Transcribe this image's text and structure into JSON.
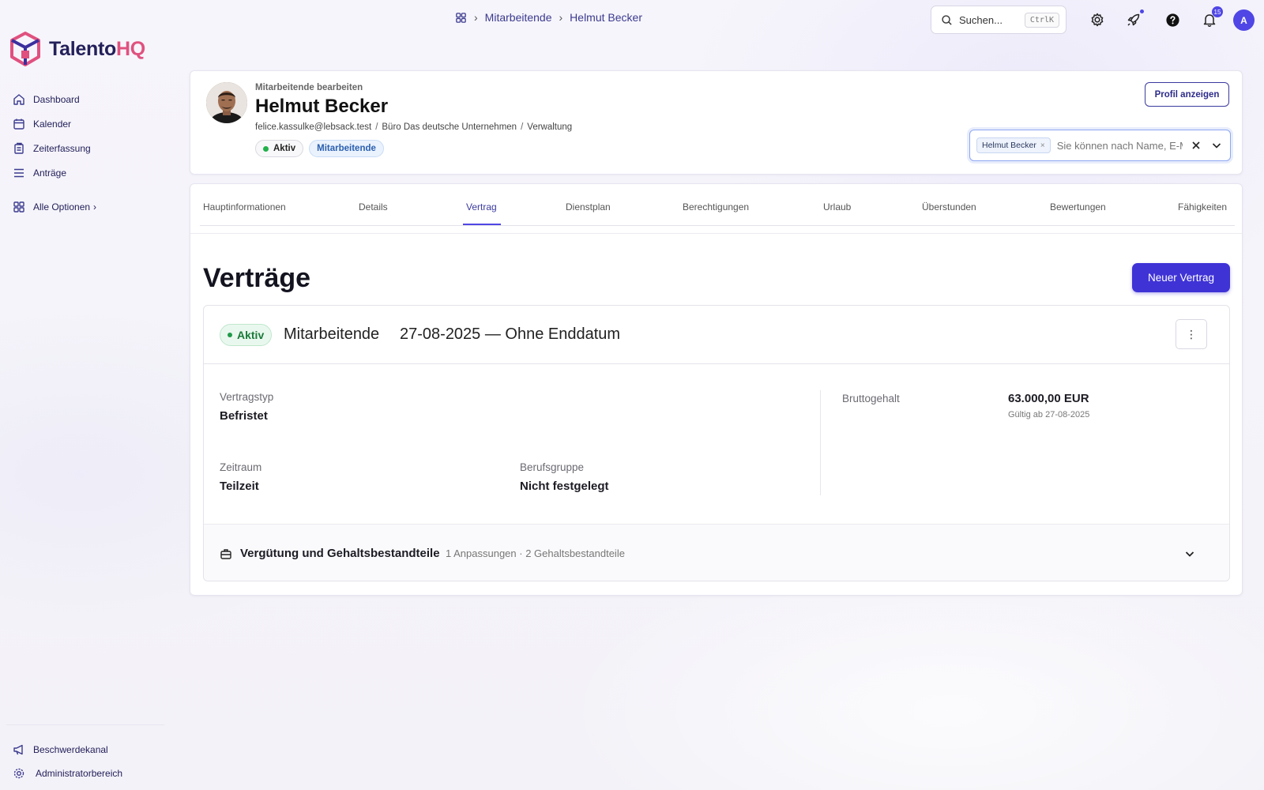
{
  "brand": {
    "name_a": "Talento",
    "name_b": "HQ",
    "accent": "#4f46e5",
    "brand_pink": "#e0517f"
  },
  "sidebar": {
    "items": [
      {
        "label": "Dashboard",
        "icon": "home-icon"
      },
      {
        "label": "Kalender",
        "icon": "calendar-icon"
      },
      {
        "label": "Zeiterfassung",
        "icon": "timesheet-icon"
      },
      {
        "label": "Anträge",
        "icon": "requests-icon"
      }
    ],
    "all_options": "Alle Optionen",
    "bottom": [
      {
        "label": "Beschwerdekanal",
        "icon": "megaphone-icon"
      },
      {
        "label": "Administratorbereich",
        "icon": "gear-icon"
      }
    ]
  },
  "topbar": {
    "breadcrumb": [
      "Mitarbeitende",
      "Helmut Becker"
    ],
    "search_placeholder": "Suchen...",
    "search_shortcut": "CtrlK",
    "notification_count": "15",
    "avatar_initial": "A"
  },
  "employee": {
    "subtitle": "Mitarbeitende bearbeiten",
    "name": "Helmut Becker",
    "email": "felice.kassulke@lebsack.test",
    "office": "Büro Das deutsche Unternehmen",
    "department": "Verwaltung",
    "status": "Aktiv",
    "role": "Mitarbeitende",
    "profile_button": "Profil anzeigen",
    "selector_chip": "Helmut Becker",
    "selector_placeholder": "Sie können nach Name, E-Mail suchen"
  },
  "tabs": [
    "Hauptinformationen",
    "Details",
    "Vertrag",
    "Dienstplan",
    "Berechtigungen",
    "Urlaub",
    "Überstunden",
    "Bewertungen",
    "Fähigkeiten"
  ],
  "active_tab": "Vertrag",
  "contracts": {
    "title": "Verträge",
    "new_button": "Neuer Vertrag",
    "item": {
      "status": "Aktiv",
      "role": "Mitarbeitende",
      "dates": "27-08-2025 — Ohne Enddatum",
      "type_label": "Vertragstyp",
      "type_value": "Befristet",
      "period_label": "Zeitraum",
      "period_value": "Teilzeit",
      "group_label": "Berufsgruppe",
      "group_value": "Nicht festgelegt",
      "salary_label": "Bruttogehalt",
      "salary_value": "63.000,00 EUR",
      "salary_valid": "Gültig ab 27-08-2025",
      "comp_title": "Vergütung und Gehaltsbestandteile",
      "comp_meta": "1 Anpassungen · 2 Gehaltsbestandteile"
    }
  }
}
